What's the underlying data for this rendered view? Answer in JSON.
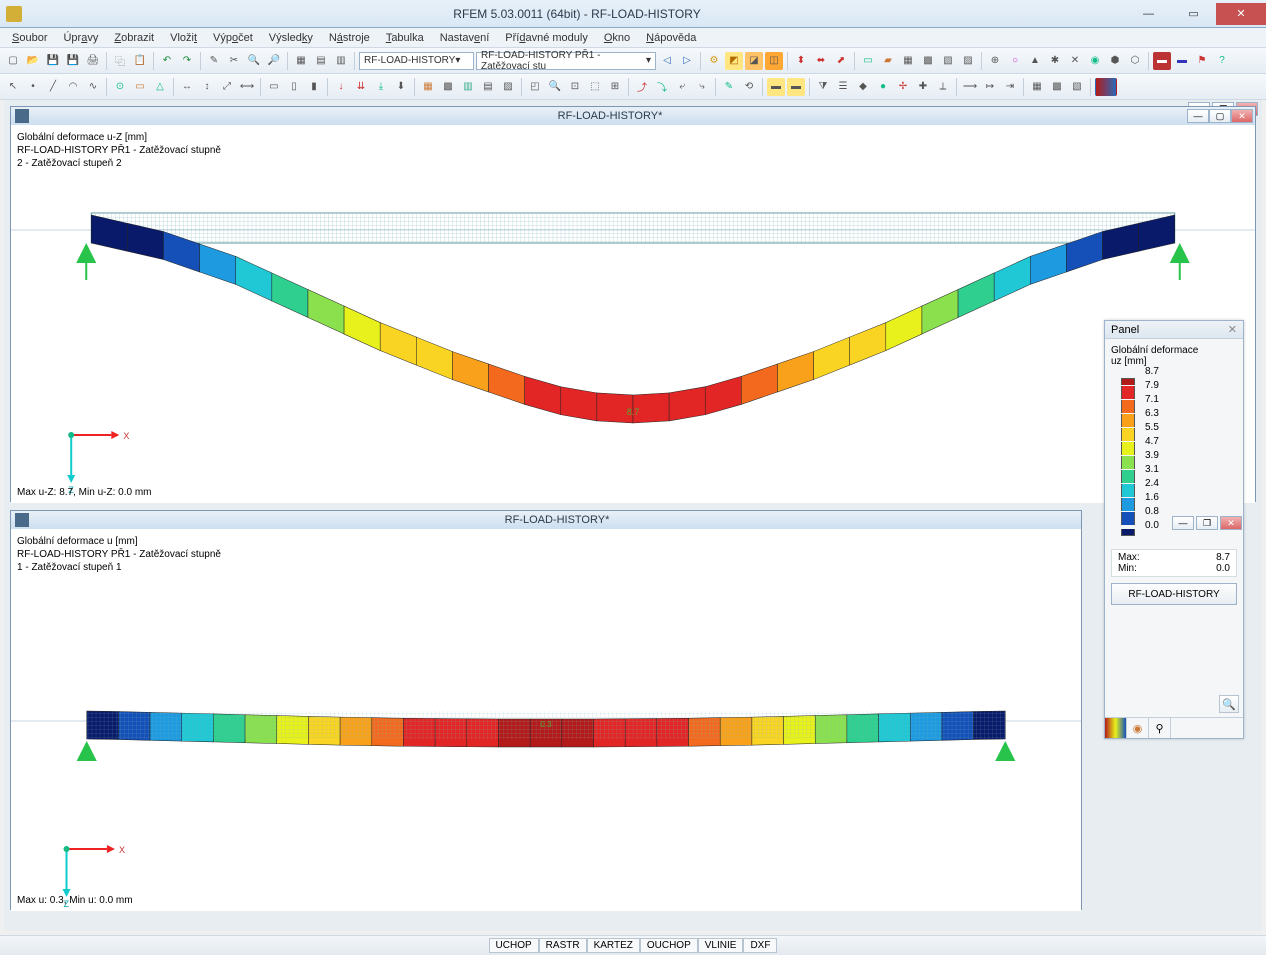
{
  "app": {
    "title": "RFEM 5.03.0011 (64bit) - RF-LOAD-HISTORY"
  },
  "menu": {
    "items": [
      "Soubor",
      "Úpravy",
      "Zobrazit",
      "Vložit",
      "Výpočet",
      "Výsledky",
      "Nástroje",
      "Tabulka",
      "Nastavení",
      "Přídavné moduly",
      "Okno",
      "Nápověda"
    ]
  },
  "toolbar": {
    "combo_module": "RF-LOAD-HISTORY",
    "combo_case": "RF-LOAD-HISTORY PŘ1 - Zatěžovací stu"
  },
  "mdi": {
    "child_title": "RF-LOAD-HISTORY*"
  },
  "view_top": {
    "line1": "Globální deformace u-Z [mm]",
    "line2": "RF-LOAD-HISTORY PŘ1 - Zatěžovací stupně",
    "line3": "2 - Zatěžovací stupeň 2",
    "peak_label": "8.7",
    "status": "Max u-Z: 8.7, Min u-Z: 0.0 mm",
    "axis_x": "X",
    "axis_z": "Z"
  },
  "view_bottom": {
    "line1": "Globální deformace u [mm]",
    "line2": "RF-LOAD-HISTORY PŘ1 - Zatěžovací stupně",
    "line3": "1 - Zatěžovací stupeň 1",
    "peak_label": "0.3",
    "status": "Max u: 0.3, Min u: 0.0 mm",
    "axis_x": "X",
    "axis_z": "Z"
  },
  "panel": {
    "title": "Panel",
    "header1": "Globální deformace",
    "header2": "uz [mm]",
    "legend": [
      {
        "c": "#b31b1b",
        "v": "8.7"
      },
      {
        "c": "#e22626",
        "v": "7.9"
      },
      {
        "c": "#f36a1e",
        "v": "7.1"
      },
      {
        "c": "#f9a11b",
        "v": "6.3"
      },
      {
        "c": "#f9d423",
        "v": "5.5"
      },
      {
        "c": "#e8f11b",
        "v": "4.7"
      },
      {
        "c": "#8be04e",
        "v": "3.9"
      },
      {
        "c": "#2ecf8f",
        "v": "3.1"
      },
      {
        "c": "#1fc8d4",
        "v": "2.4"
      },
      {
        "c": "#1e9be0",
        "v": "1.6"
      },
      {
        "c": "#1450b8",
        "v": "0.8"
      },
      {
        "c": "#0a1a6a",
        "v": "0.0"
      }
    ],
    "max_label": "Max:",
    "max_val": "8.7",
    "min_label": "Min:",
    "min_val": "0.0",
    "button": "RF-LOAD-HISTORY"
  },
  "statusbar": {
    "items": [
      "UCHOP",
      "RASTR",
      "KARTEZ",
      "OUCHOP",
      "VLINIE",
      "DXF"
    ]
  },
  "chart_data": {
    "type": "heatmap",
    "description": "Two beam deflection contour plots",
    "colorscale_label": "Globální deformace uz [mm]",
    "colorscale": [
      {
        "value": 8.7,
        "color": "#b31b1b"
      },
      {
        "value": 7.9,
        "color": "#e22626"
      },
      {
        "value": 7.1,
        "color": "#f36a1e"
      },
      {
        "value": 6.3,
        "color": "#f9a11b"
      },
      {
        "value": 5.5,
        "color": "#f9d423"
      },
      {
        "value": 4.7,
        "color": "#e8f11b"
      },
      {
        "value": 3.9,
        "color": "#8be04e"
      },
      {
        "value": 3.1,
        "color": "#2ecf8f"
      },
      {
        "value": 2.4,
        "color": "#1fc8d4"
      },
      {
        "value": 1.6,
        "color": "#1e9be0"
      },
      {
        "value": 0.8,
        "color": "#1450b8"
      },
      {
        "value": 0.0,
        "color": "#0a1a6a"
      }
    ],
    "plots": [
      {
        "title": "2 - Zatěžovací stupeň 2",
        "quantity": "u-Z [mm]",
        "max": 8.7,
        "min": 0.0,
        "span_segments": 30,
        "values_along_span": [
          0.0,
          0.4,
          0.8,
          1.4,
          2.0,
          2.8,
          3.6,
          4.4,
          5.2,
          5.9,
          6.6,
          7.2,
          7.8,
          8.3,
          8.6,
          8.7,
          8.6,
          8.3,
          7.8,
          7.2,
          6.6,
          5.9,
          5.2,
          4.4,
          3.6,
          2.8,
          2.0,
          1.4,
          0.8,
          0.4,
          0.0
        ]
      },
      {
        "title": "1 - Zatěžovací stupeň 1",
        "quantity": "u [mm]",
        "max": 0.3,
        "min": 0.0,
        "span_segments": 30,
        "values_along_span": [
          0.0,
          0.02,
          0.05,
          0.08,
          0.11,
          0.14,
          0.17,
          0.2,
          0.23,
          0.25,
          0.27,
          0.28,
          0.29,
          0.3,
          0.3,
          0.3,
          0.3,
          0.29,
          0.28,
          0.27,
          0.25,
          0.23,
          0.2,
          0.17,
          0.14,
          0.11,
          0.08,
          0.05,
          0.02,
          0.0
        ]
      }
    ]
  }
}
